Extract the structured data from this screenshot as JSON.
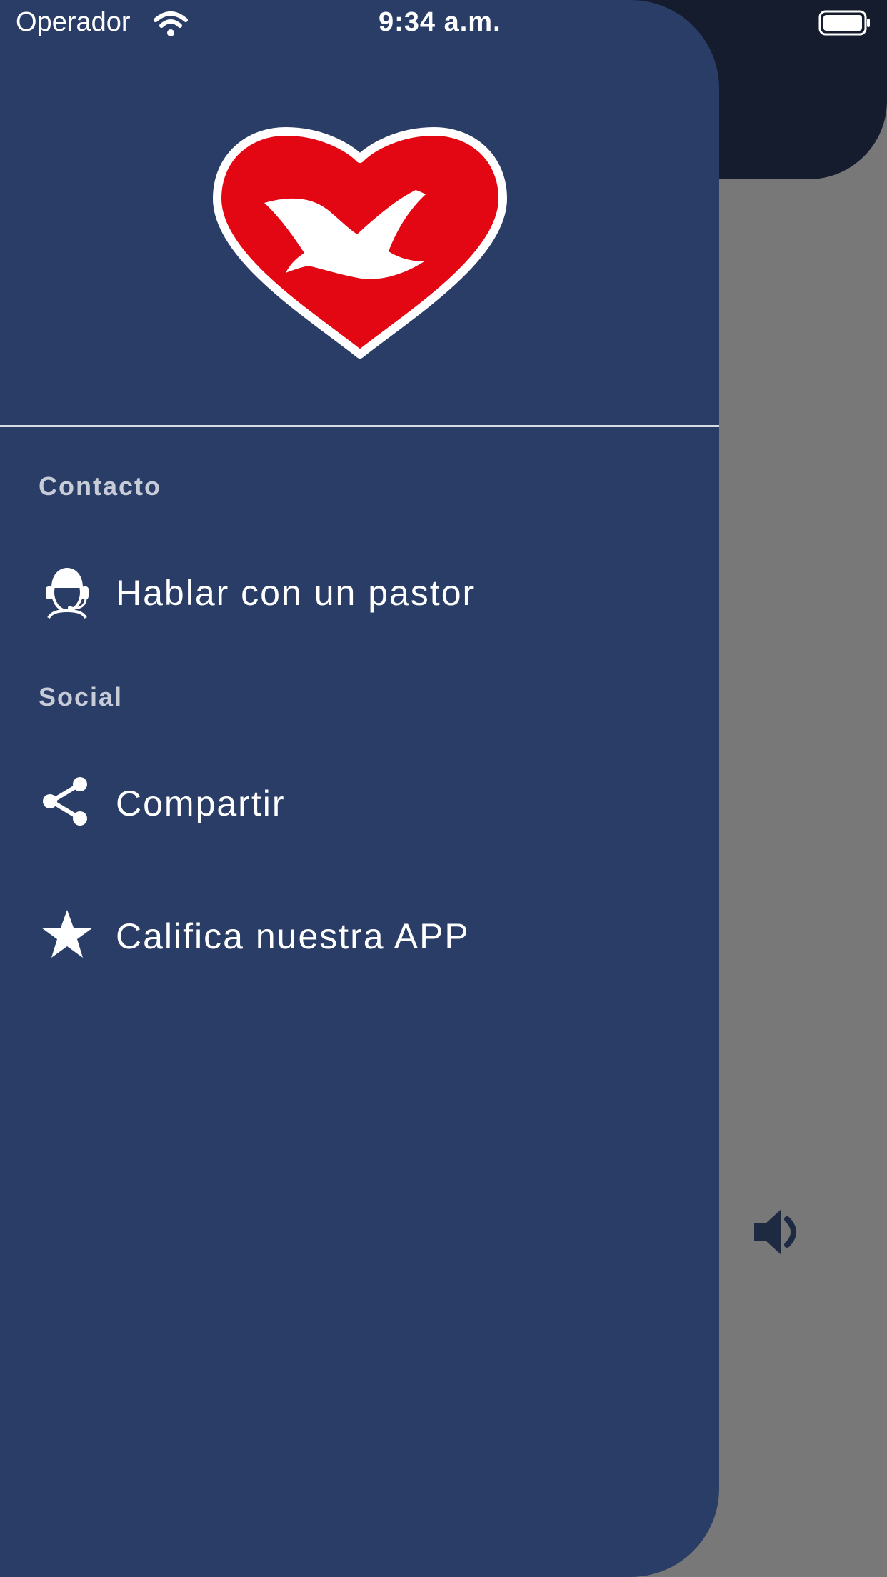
{
  "status_bar": {
    "carrier": "Operador",
    "time": "9:34 a.m."
  },
  "drawer": {
    "sections": [
      {
        "title": "Contacto",
        "items": [
          {
            "label": "Hablar con un pastor",
            "icon": "headset-person-icon"
          }
        ]
      },
      {
        "title": "Social",
        "items": [
          {
            "label": "Compartir",
            "icon": "share-icon"
          },
          {
            "label": "Califica nuestra APP",
            "icon": "star-icon"
          }
        ]
      }
    ]
  },
  "colors": {
    "drawer_bg": "#2a3d66",
    "logo_red": "#e30613",
    "scrim": "#787878",
    "header_dark": "#141c2e"
  }
}
